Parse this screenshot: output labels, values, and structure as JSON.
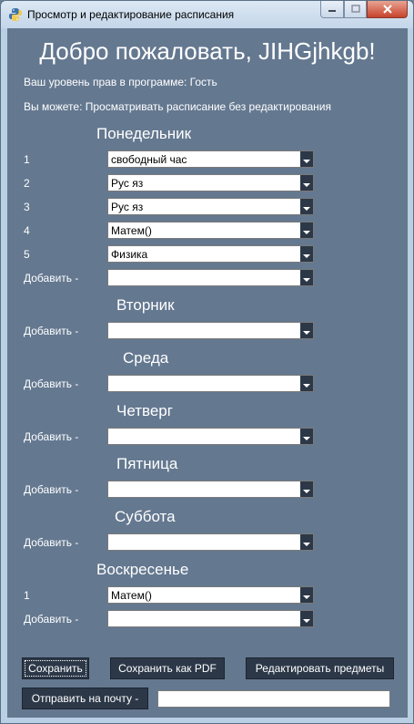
{
  "window": {
    "title": "Просмотр и редактирование расписания"
  },
  "greeting": "Добро пожаловать, JIHGjhkgb!",
  "access_level": "Ваш уровень прав в программе: Гость",
  "permissions": "Вы можете: Просматривать расписание без редактирования",
  "days": {
    "monday": {
      "name": "Понедельник",
      "lessons": [
        {
          "num": "1",
          "value": "свободный час"
        },
        {
          "num": "2",
          "value": "Рус яз"
        },
        {
          "num": "3",
          "value": "Рус яз"
        },
        {
          "num": "4",
          "value": "Матем()"
        },
        {
          "num": "5",
          "value": "Физика"
        }
      ],
      "add_label": "Добавить -"
    },
    "tuesday": {
      "name": "Вторник",
      "add_label": "Добавить -"
    },
    "wednesday": {
      "name": "Среда",
      "add_label": "Добавить -"
    },
    "thursday": {
      "name": "Четверг",
      "add_label": "Добавить -"
    },
    "friday": {
      "name": "Пятница",
      "add_label": "Добавить -"
    },
    "saturday": {
      "name": "Суббота",
      "add_label": "Добавить -"
    },
    "sunday": {
      "name": "Воскресенье",
      "lessons": [
        {
          "num": "1",
          "value": "Матем()"
        }
      ],
      "add_label": "Добавить -"
    }
  },
  "buttons": {
    "save": "Сохранить",
    "save_pdf": "Сохранить как PDF",
    "edit_subjects": "Редактировать предметы",
    "send_email": "Отправить на почту -"
  },
  "email_field": {
    "value": ""
  },
  "colors": {
    "background": "#647890",
    "button": "#2c3848",
    "text": "#ffffff"
  }
}
